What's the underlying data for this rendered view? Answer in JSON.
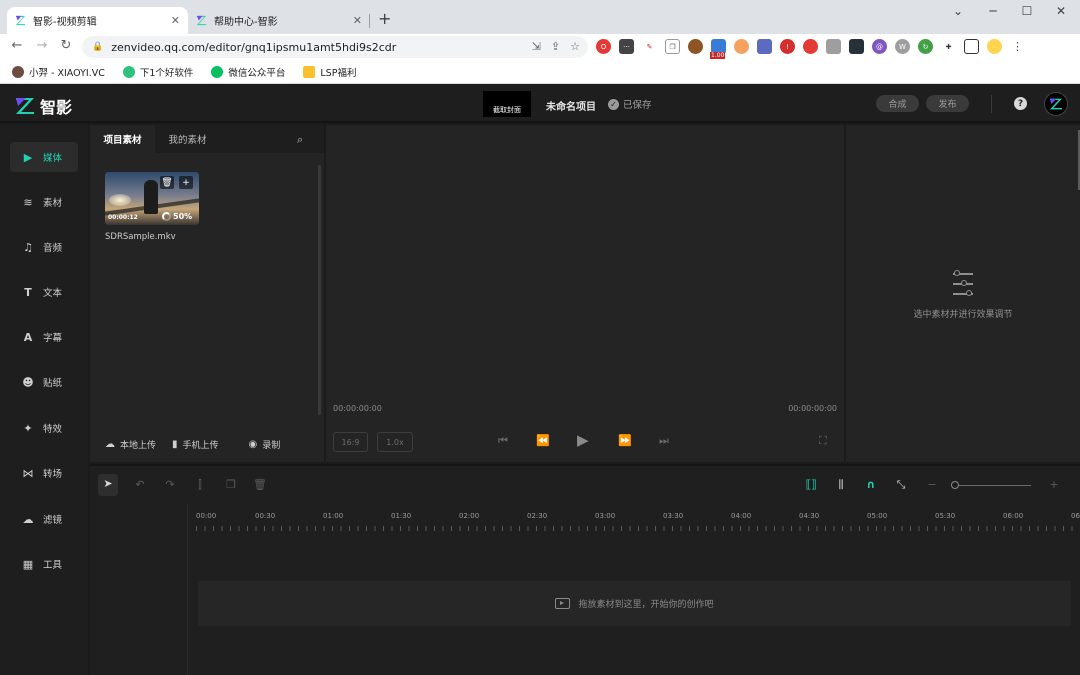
{
  "browser": {
    "tabs": [
      {
        "title": "智影-视频剪辑",
        "close": "✕"
      },
      {
        "title": "帮助中心-智影",
        "close": "✕"
      }
    ],
    "new_tab": "+",
    "window_controls": {
      "minimize": "⌄",
      "min": "─",
      "max": "☐",
      "close": "✕"
    },
    "url": "zenvideo.qq.com/editor/gnq1ipsmu1amt5hdi9s2cdr",
    "extension_badge": "1.00",
    "bookmarks": [
      "小羿 - XIAOYI.VC",
      "下1个好软件",
      "微信公众平台",
      "LSP福利"
    ]
  },
  "app": {
    "logo_text": "智影",
    "cover_button": "截取封面",
    "project_name": "未命名项目",
    "saved_status": "已保存",
    "compose_button": "合成",
    "publish_button": "发布",
    "help": "?"
  },
  "nav": {
    "items": [
      {
        "label": "媒体",
        "icon": "media-icon"
      },
      {
        "label": "素材",
        "icon": "layers-icon"
      },
      {
        "label": "音频",
        "icon": "music-icon"
      },
      {
        "label": "文本",
        "icon": "text-icon"
      },
      {
        "label": "字幕",
        "icon": "subtitle-icon"
      },
      {
        "label": "贴纸",
        "icon": "sticker-icon"
      },
      {
        "label": "特效",
        "icon": "sparkle-icon"
      },
      {
        "label": "转场",
        "icon": "transition-icon"
      },
      {
        "label": "滤镜",
        "icon": "filter-icon"
      },
      {
        "label": "工具",
        "icon": "tools-icon"
      }
    ]
  },
  "media": {
    "tabs": [
      "项目素材",
      "我的素材"
    ],
    "clip": {
      "duration": "00:00:12",
      "progress": "50%",
      "progress_value": 0.5,
      "filename": "SDRSample.mkv"
    },
    "footer": [
      "本地上传",
      "手机上传",
      "录制"
    ]
  },
  "preview": {
    "time_left": "00:00:00:00",
    "time_right": "00:00:00:00",
    "ratio": "16:9",
    "speed": "1.0x"
  },
  "props": {
    "hint": "选中素材并进行效果调节"
  },
  "timeline": {
    "ruler": [
      "00:00",
      "00:30",
      "01:00",
      "01:30",
      "02:00",
      "02:30",
      "03:00",
      "03:30",
      "04:00",
      "04:30",
      "05:00",
      "05:30",
      "06:00",
      "06"
    ],
    "drop_hint": "拖放素材到这里，开始你的创作吧"
  },
  "colors": {
    "accent": "#1fd2b2",
    "background": "#1b1b1b",
    "panel": "#242424"
  }
}
